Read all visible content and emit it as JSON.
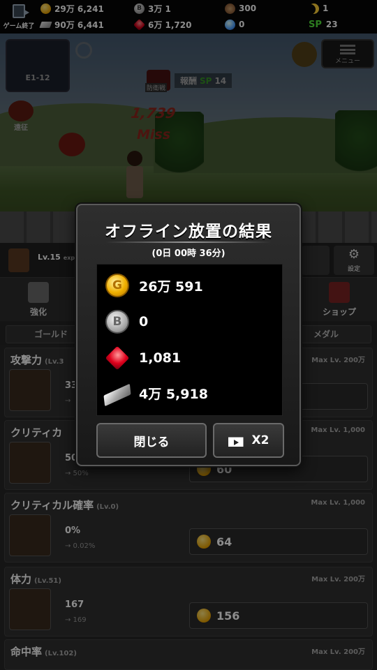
{
  "top_bar": {
    "exit_label": "ゲーム終了",
    "gold": "29万 6,241",
    "silver_b": "3万 1",
    "hero_count": "300",
    "moon": "1",
    "ingot": "90万 6,441",
    "ruby": "6万 1,720",
    "orb": "0",
    "sp_label": "SP",
    "sp_value": "23"
  },
  "scene": {
    "stage": "E1-12",
    "menu_label": "メニュー",
    "reward_box_label": "防衛戦",
    "reward_label": "報酬",
    "reward_sp_label": "SP",
    "reward_sp_value": "14",
    "expedition_label": "遠征",
    "damage": "1,739",
    "miss": "Miss"
  },
  "status": {
    "level": "Lv.15",
    "exp_label": "exp",
    "settings_label": "設定"
  },
  "tabs": {
    "enhance": "強化",
    "shop": "ショップ"
  },
  "subtabs": {
    "gold": "ゴールド",
    "medal": "メダル"
  },
  "stats": [
    {
      "name": "攻撃力",
      "lv": "(Lv.3",
      "max": "Max Lv. 200万",
      "value": "33",
      "next": "→",
      "cost": ""
    },
    {
      "name": "クリティカ",
      "lv": "",
      "max": "Max Lv. 1,000",
      "value": "50",
      "next": "→ 50%",
      "cost": "60"
    },
    {
      "name": "クリティカル確率",
      "lv": "(Lv.0)",
      "max": "Max Lv. 1,000",
      "value": "0%",
      "next": "→ 0.02%",
      "cost": "64"
    },
    {
      "name": "体力",
      "lv": "(Lv.51)",
      "max": "Max Lv. 200万",
      "value": "167",
      "next": "→ 169",
      "cost": "156"
    },
    {
      "name": "命中率",
      "lv": "(Lv.102)",
      "max": "Max Lv. 200万",
      "value": "",
      "next": "",
      "cost": ""
    }
  ],
  "dialog": {
    "title": "オフライン放置の結果",
    "subtitle": "(0日 00時 36分)",
    "rewards": [
      {
        "icon": "gold-coin-icon",
        "glyph": "G",
        "value": "26万 591"
      },
      {
        "icon": "b-coin-icon",
        "glyph": "B",
        "value": "0"
      },
      {
        "icon": "ruby-icon",
        "glyph": "",
        "value": "1,081"
      },
      {
        "icon": "ingot-icon",
        "glyph": "",
        "value": "4万 5,918"
      }
    ],
    "close_label": "閉じる",
    "double_label": "X2"
  }
}
